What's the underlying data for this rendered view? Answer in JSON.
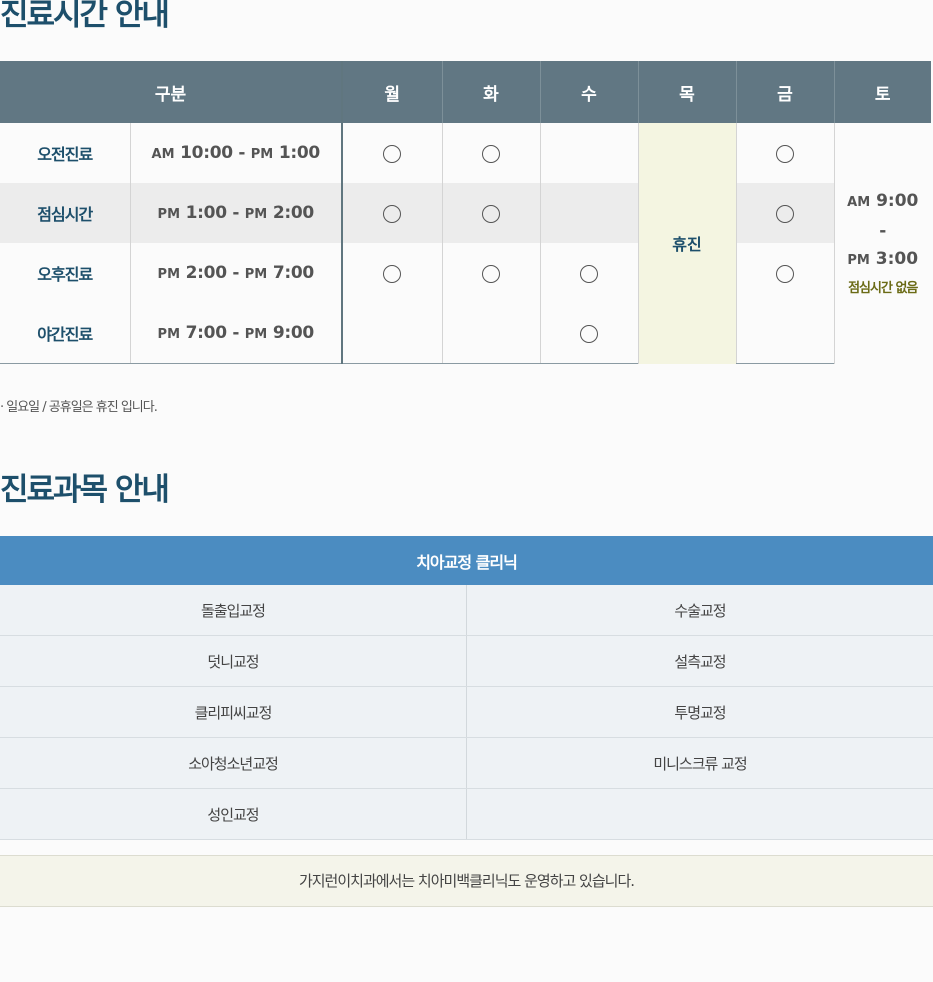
{
  "titles": {
    "hours": "진료시간 안내",
    "subjects": "진료과목 안내"
  },
  "schedule": {
    "header": [
      "구분",
      "월",
      "화",
      "수",
      "목",
      "금",
      "토"
    ],
    "rows": [
      {
        "label": "오전진료",
        "start_ap": "AM",
        "start": "10:00",
        "dash": "-",
        "end_ap": "PM",
        "end": "1:00",
        "mon": true,
        "tue": true,
        "wed": false,
        "fri": true
      },
      {
        "label": "점심시간",
        "start_ap": "PM",
        "start": "1:00",
        "dash": "-",
        "end_ap": "PM",
        "end": "2:00",
        "mon": true,
        "tue": true,
        "wed": false,
        "fri": true
      },
      {
        "label": "오후진료",
        "start_ap": "PM",
        "start": "2:00",
        "dash": "-",
        "end_ap": "PM",
        "end": "7:00",
        "mon": true,
        "tue": true,
        "wed": true,
        "fri": true
      },
      {
        "label": "야간진료",
        "start_ap": "PM",
        "start": "7:00",
        "dash": "-",
        "end_ap": "PM",
        "end": "9:00",
        "mon": false,
        "tue": false,
        "wed": true,
        "fri": false
      }
    ],
    "thursday": "휴진",
    "saturday": {
      "start_ap": "AM",
      "start": "9:00",
      "dash": "-",
      "end_ap": "PM",
      "end": "3:00",
      "note": "점심시간 없음"
    }
  },
  "note": "· 일요일 / 공휴일은 휴진 입니다.",
  "clinic": {
    "header": "치아교정 클리닉",
    "items": [
      [
        "돌출입교정",
        "수술교정"
      ],
      [
        "덧니교정",
        "설측교정"
      ],
      [
        "클리피씨교정",
        "투명교정"
      ],
      [
        "소아청소년교정",
        "미니스크류 교정"
      ],
      [
        "성인교정",
        ""
      ]
    ]
  },
  "footer": "가지런이치과에서는 치아미백클리닉도 운영하고 있습니다.",
  "colors": {
    "title": "#1d4f6b",
    "schedule_header": "#617783",
    "clinic_header": "#4b8cc1",
    "thursday_bg": "#f4f5e1",
    "saturday_note": "#6b6b16"
  }
}
